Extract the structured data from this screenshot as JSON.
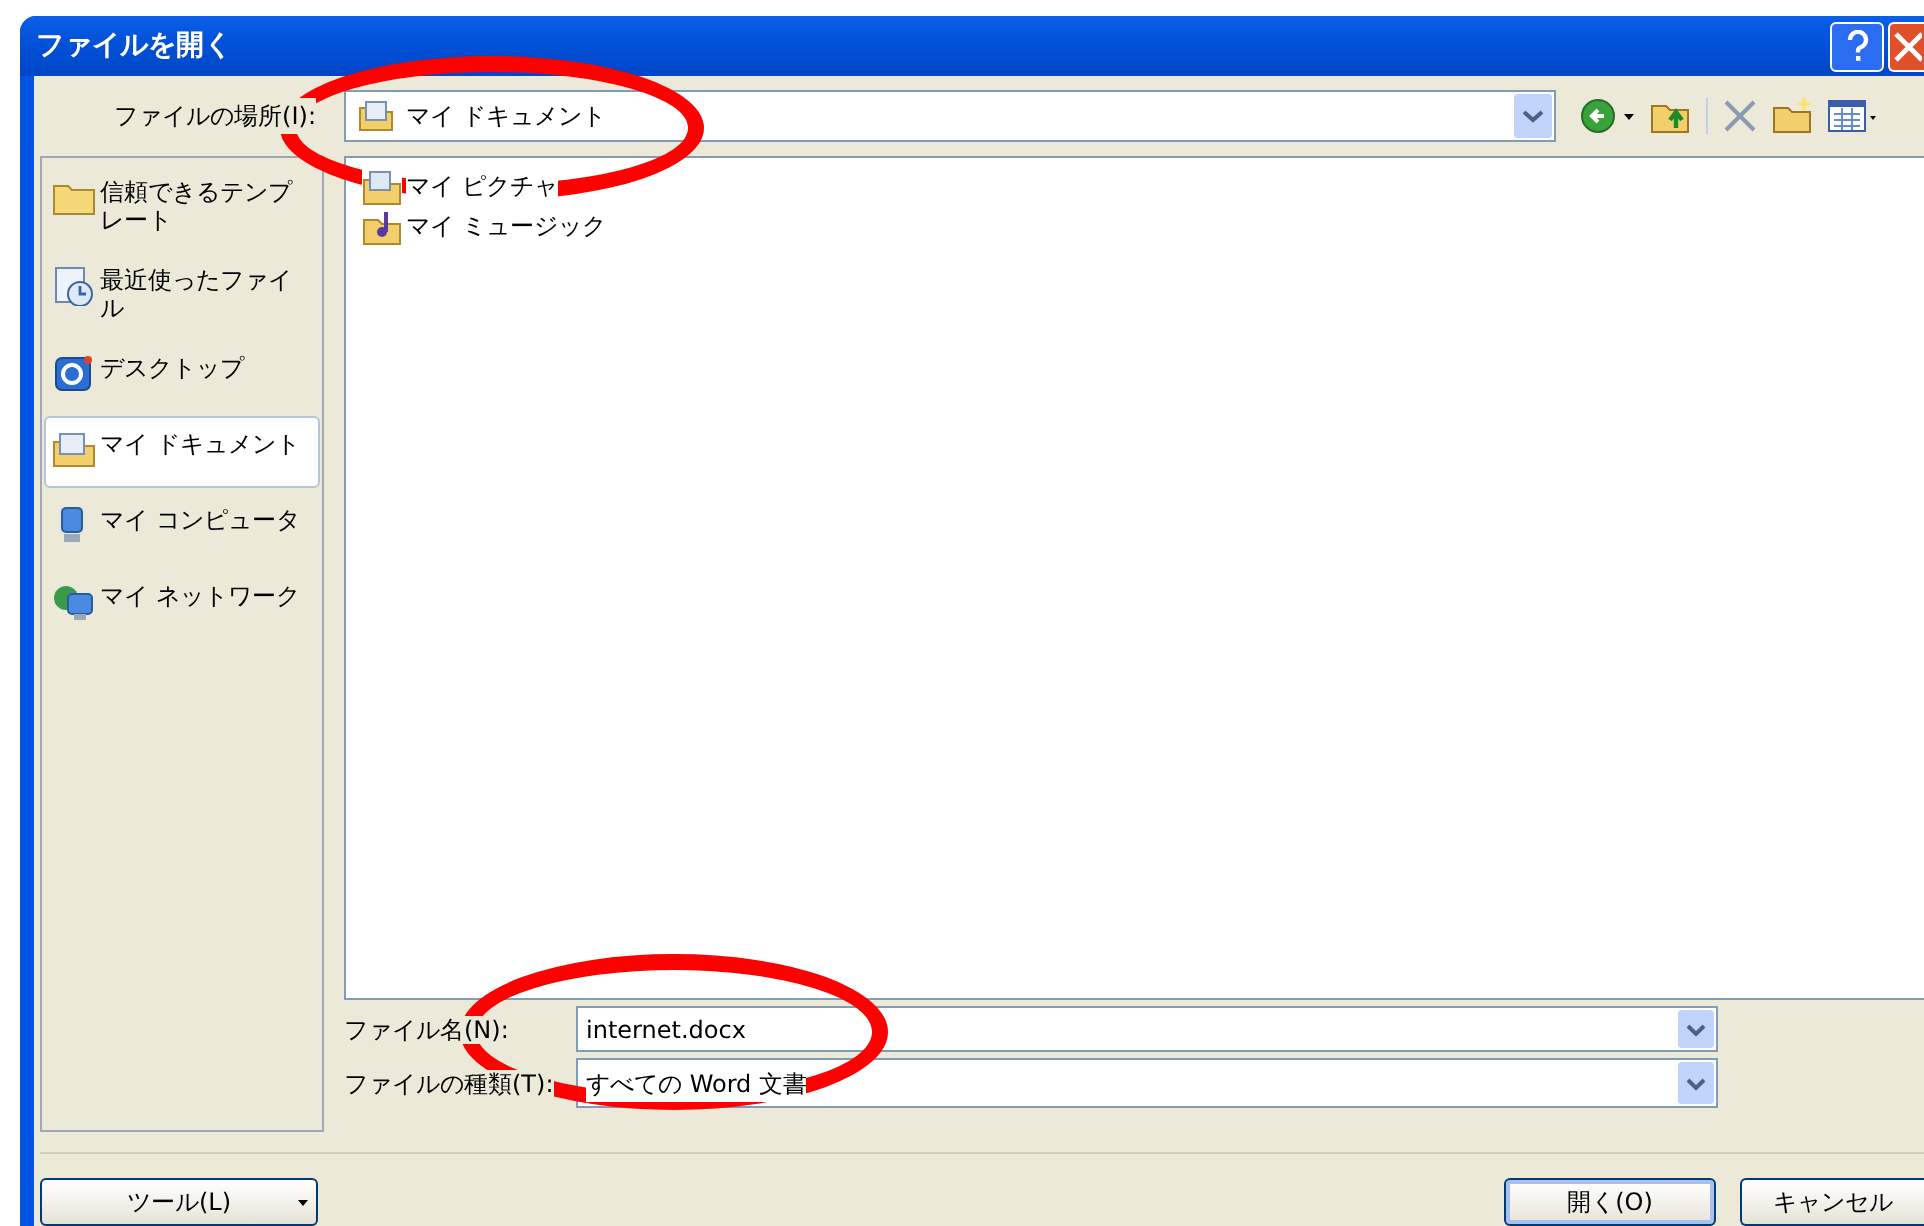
{
  "window": {
    "title": "ファイルを開く"
  },
  "location": {
    "label": "ファイルの場所(I):",
    "value": "マイ ドキュメント"
  },
  "places": [
    {
      "label": "信頼できるテンプレート",
      "selected": false
    },
    {
      "label": "最近使ったファイル",
      "selected": false
    },
    {
      "label": "デスクトップ",
      "selected": false
    },
    {
      "label": "マイ ドキュメント",
      "selected": true
    },
    {
      "label": "マイ コンピュータ",
      "selected": false
    },
    {
      "label": "マイ ネットワーク",
      "selected": false
    }
  ],
  "files": [
    {
      "name": "マイ ピクチャ"
    },
    {
      "name": "マイ ミュージック"
    }
  ],
  "file_name": {
    "label": "ファイル名(N):",
    "value": "internet.docx"
  },
  "file_type": {
    "label": "ファイルの種類(T):",
    "value": "すべての Word 文書"
  },
  "buttons": {
    "tools": "ツール(L)",
    "open": "開く(O)",
    "cancel": "キャンセル"
  },
  "annotations": [
    {
      "kind": "ellipse"
    },
    {
      "kind": "ellipse"
    }
  ]
}
